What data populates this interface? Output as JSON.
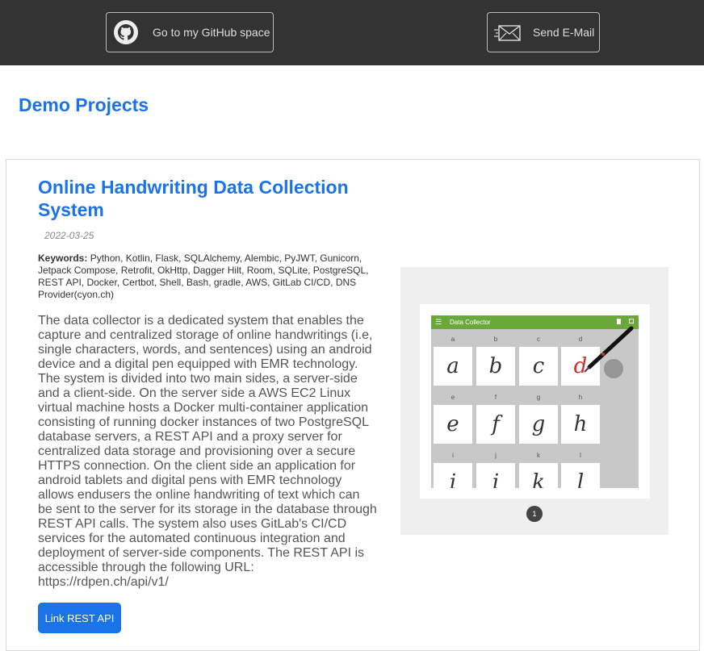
{
  "header": {
    "github_label": "Go to my GitHub space",
    "email_label": "Send E-Mail"
  },
  "section": {
    "title": "Demo Projects"
  },
  "project": {
    "title": "Online Handwriting Data Collection System",
    "date": "2022-03-25",
    "keywords_label": "Keywords:",
    "keywords": "Python, Kotlin, Flask, SQLAlchemy, Alembic, PyJWT, Gunicorn, Jetpack Compose, Retrofit, OkHttp, Dagger Hilt, Room, SQLite, PostgreSQL, REST API, Docker, Certbot, Shell, Bash, gradle, AWS, GitLab CI/CD, DNS Provider(cyon.ch)",
    "description": "The data collector is a dedicated system that enables the capture and centralized storage of online handwritings (i.e, single characters, words, and sentences) using an android device and a digital pen equipped with EMR technology. The system is divided into two main sides, a server-side and a client-side. On the server side a AWS EC2 Linux virtual machine hosts a Docker multi-container application consisting of running docker instances of two PostgreSQL database servers, a REST API and a proxy server for centralized data storage and provisioning over a secure HTTPS connection. On the client side an application for android tablets and digital pens with EMR technology allows endusers the online handwriting of text which can be sent to the server for its storage in the database through REST API calls. The system also uses GitLab's CI/CD services for the automated continuous integration and deployment of server-side components. The REST API is accessible through the following URL: https://rdpen.ch/api/v1/",
    "button_label": "Link REST API"
  },
  "carousel": {
    "app_title": "Data Collector",
    "labels": [
      "a",
      "b",
      "c",
      "d",
      "e",
      "f",
      "g",
      "h",
      "i",
      "j",
      "k",
      "l"
    ],
    "glyphs": [
      "a",
      "b",
      "c",
      "d",
      "e",
      "f",
      "g",
      "h",
      "i",
      "i",
      "k",
      "l"
    ],
    "active_color": "#d32f2f",
    "accent_color": "#6aa83a",
    "page_indicator": "1"
  },
  "colors": {
    "link_blue": "#1a73e8",
    "topbar": "#333333"
  }
}
